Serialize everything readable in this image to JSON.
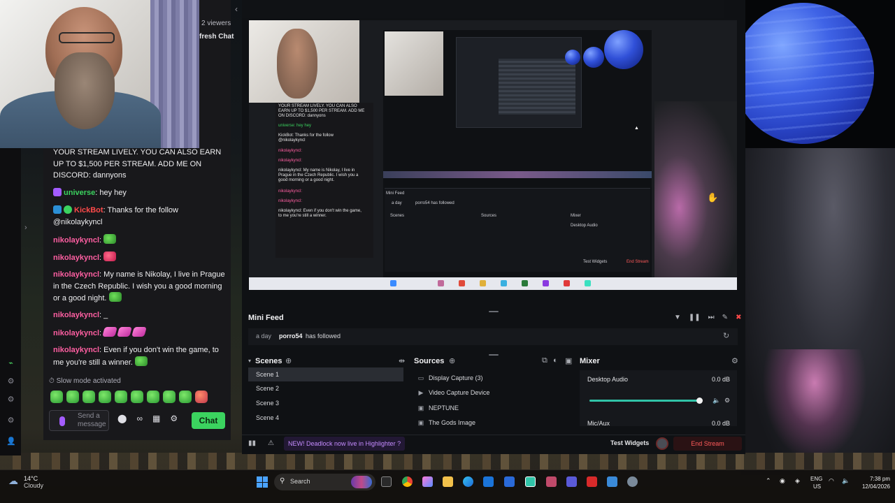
{
  "stream_header": {
    "viewers": "2 viewers",
    "refresh_chat": "fresh Chat"
  },
  "chat": {
    "messages": [
      {
        "user": "",
        "text": "YOUR STREAM LIVELY. YOU CAN ALSO EARN UP TO $1,500 PER STREAM. ADD ME ON DISCORD: dannyons"
      },
      {
        "user": "universe",
        "text": ": hey hey"
      },
      {
        "user": "KickBot",
        "text": ": Thanks for the follow @nikolaykyncl"
      },
      {
        "user": "nikolaykyncl",
        "text": ":"
      },
      {
        "user": "nikolaykyncl",
        "text": ":"
      },
      {
        "user": "nikolaykyncl",
        "text": ": My name is Nikolay, I live in Prague in the Czech Republic. I wish you a good morning or a good night."
      },
      {
        "user": "nikolaykyncl",
        "text": ": _"
      },
      {
        "user": "nikolaykyncl",
        "text": ":"
      },
      {
        "user": "nikolaykyncl",
        "text": ": Even if you don't win the game, to me you're still a winner."
      }
    ],
    "slow_mode": "Slow mode activated",
    "input_placeholder": "Send a message",
    "chat_button": "Chat"
  },
  "mini_feed": {
    "title": "Mini Feed",
    "events": [
      {
        "time": "a day",
        "user": "porro54",
        "action": "has followed"
      }
    ]
  },
  "scenes": {
    "title": "Scenes",
    "items": [
      "Scene 1",
      "Scene 2",
      "Scene 3",
      "Scene 4"
    ],
    "active": "Scene 1"
  },
  "sources": {
    "title": "Sources",
    "items": [
      {
        "label": "Display Capture (3)",
        "icon": "monitor-icon"
      },
      {
        "label": "Video Capture Device",
        "icon": "camera-icon"
      },
      {
        "label": "NEPTUNE",
        "icon": "image-icon"
      },
      {
        "label": "The Gods Image",
        "icon": "image-icon"
      }
    ]
  },
  "mixer": {
    "title": "Mixer",
    "channels": [
      {
        "name": "Desktop Audio",
        "db": "0.0 dB",
        "level": 0.98
      },
      {
        "name": "Mic/Aux",
        "db": "0.0 dB"
      }
    ]
  },
  "status_bar": {
    "news": "NEW! Deadlock now live in Highlighter ?",
    "test_widgets": "Test Widgets",
    "end_stream": "End Stream"
  },
  "preview_chat": {
    "lines": [
      "YOUR STREAM LIVELY. YOU CAN ALSO",
      "EARN UP TO $1,500 PER STREAM. ADD ME",
      "ON DISCORD: dannyons",
      "universe: hey hey",
      "KickBot: Thanks for the follow",
      "@nikolaykyncl",
      "nikolaykyncl:",
      "nikolaykyncl:",
      "nikolaykyncl: My name is Nikolay, I live in",
      "Prague in the Czech Republic. I wish you a",
      "good morning or a good night.",
      "nikolaykyncl:",
      "nikolaykyncl:",
      "nikolaykyncl: Even if you don't win the game,",
      "to me you're still a winner."
    ],
    "mini_feed": "Mini Feed",
    "feed_time": "a day",
    "feed_event": "porro54 has followed",
    "scenes": "Scenes",
    "sources": "Sources",
    "mixer": "Mixer",
    "desktop_audio": "Desktop Audio",
    "test_widgets": "Test Widgets",
    "end_stream": "End Stream"
  },
  "taskbar": {
    "weather_temp": "14°C",
    "weather_desc": "Cloudy",
    "search": "Search",
    "lang_1": "ENG",
    "lang_2": "US",
    "time": "7:38 pm",
    "date": "12/04/2026"
  },
  "colors": {
    "accent_green": "#3bd35f",
    "username_pink": "#ff5fa2",
    "end_stream_red": "#ff5a5a",
    "neptune_blue": "#3f63e6"
  }
}
